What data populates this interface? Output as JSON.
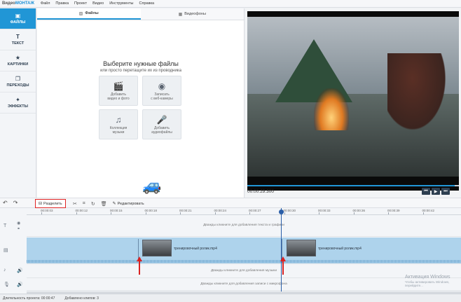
{
  "app": {
    "brand_prefix": "Видео",
    "brand_suffix": "МОНТАЖ",
    "menu": [
      "Файл",
      "Правка",
      "Проект",
      "Видео",
      "Инструменты",
      "Справка"
    ]
  },
  "leftnav": {
    "items": [
      {
        "label": "ФАЙЛЫ",
        "icon": "folder-icon",
        "glyph": "▣",
        "active": true
      },
      {
        "label": "ТЕКСТ",
        "icon": "text-icon",
        "glyph": "T",
        "active": false
      },
      {
        "label": "КАРТИНКИ",
        "icon": "star-icon",
        "glyph": "★",
        "active": false
      },
      {
        "label": "ПЕРЕХОДЫ",
        "icon": "transitions-icon",
        "glyph": "❐",
        "active": false
      },
      {
        "label": "ЭФФЕКТЫ",
        "icon": "magic-wand-icon",
        "glyph": "✦",
        "active": false
      }
    ]
  },
  "files_panel": {
    "tabs": [
      {
        "label": "Файлы",
        "active": true
      },
      {
        "label": "Видеофоны",
        "active": false
      }
    ],
    "title": "Выберите нужные файлы",
    "subtitle": "или просто перетащите их из проводника",
    "tiles": [
      {
        "line1": "Добавить",
        "line2": "видео и фото",
        "icon": "film-clapper-icon",
        "glyph": "🎬"
      },
      {
        "line1": "Записать",
        "line2": "с веб-камеры",
        "icon": "webcam-icon",
        "glyph": "◉"
      },
      {
        "line1": "Коллекция",
        "line2": "музыки",
        "icon": "music-notes-icon",
        "glyph": "♫"
      },
      {
        "line1": "Добавить",
        "line2": "аудиофайлы",
        "icon": "microphone-icon",
        "glyph": "🎤"
      }
    ]
  },
  "preview": {
    "time": "00:00:29.300",
    "progress": 0.98
  },
  "toolbar": {
    "undo_glyph": "↶",
    "redo_glyph": "↷",
    "split_label": "Разделить",
    "edit_label": "Редактировать"
  },
  "timeline": {
    "ruler": [
      "00:00:03",
      "00:00:12",
      "00:00:15",
      "00:00:18",
      "00:00:21",
      "00:00:24",
      "00:00:27",
      "00:00:30",
      "00:00:33",
      "00:00:36",
      "00:00:39",
      "00:00:42"
    ],
    "text_lane_hint": "Дважды кликните для добавления текста и графики",
    "music_lane_hint": "Дважды кликните для добавления музыки",
    "voice_lane_hint": "Дважды кликните для добавления записи с микрофона",
    "clips": [
      {
        "label": "тренировочный ролик.mp4"
      },
      {
        "label": "тренировочный ролик.mp4"
      }
    ]
  },
  "status": {
    "duration": "Длительность проекта:  00:00:47",
    "added": "Добавлено клипов: 3"
  },
  "watermark": {
    "title": "Активация Windows",
    "subtitle": "Чтобы активировать Windows, перейдите..."
  },
  "colors": {
    "accent": "#2196d6",
    "highlight": "#e02424"
  }
}
